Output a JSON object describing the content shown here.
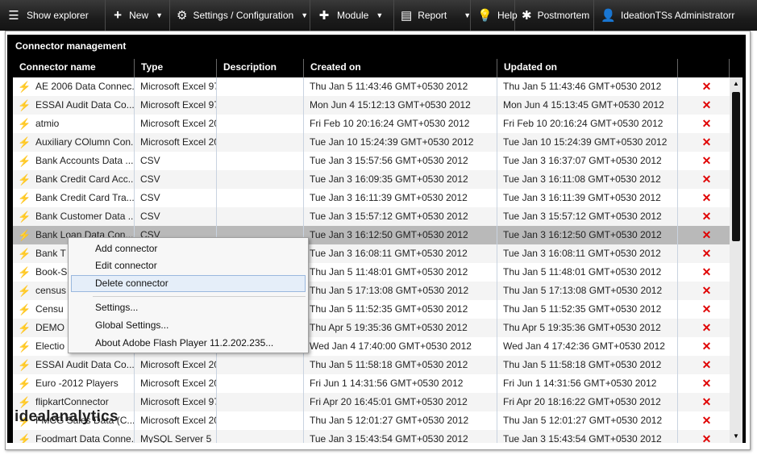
{
  "toolbar": {
    "show_explorer": "Show explorer",
    "new": "New",
    "settings": "Settings / Configuration",
    "module": "Module",
    "report": "Report",
    "help": "Help",
    "postmortem": "Postmortem",
    "user": "IdeationTSs Administratorr"
  },
  "panel": {
    "title": "Connector management"
  },
  "table": {
    "headers": [
      "Connector name",
      "Type",
      "Description",
      "Created on",
      "Updated on"
    ],
    "rows": [
      {
        "name": "AE 2006 Data Connec...",
        "type": "Microsoft Excel 97-",
        "created": "Thu Jan 5 11:43:46 GMT+0530 2012",
        "updated": "Thu Jan 5 11:43:46 GMT+0530 2012"
      },
      {
        "name": "ESSAI Audit Data Co...",
        "type": "Microsoft Excel 97-",
        "created": "Mon Jun 4 15:12:13 GMT+0530 2012",
        "updated": "Mon Jun 4 15:13:45 GMT+0530 2012"
      },
      {
        "name": "atmio",
        "type": "Microsoft Excel 200",
        "created": "Fri Feb 10 20:16:24 GMT+0530 2012",
        "updated": "Fri Feb 10 20:16:24 GMT+0530 2012"
      },
      {
        "name": "Auxiliary COlumn Con...",
        "type": "Microsoft Excel 200",
        "created": "Tue Jan 10 15:24:39 GMT+0530 2012",
        "updated": "Tue Jan 10 15:24:39 GMT+0530 2012"
      },
      {
        "name": "Bank Accounts Data ...",
        "type": "CSV",
        "created": "Tue Jan 3 15:57:56 GMT+0530 2012",
        "updated": "Tue Jan 3 16:37:07 GMT+0530 2012"
      },
      {
        "name": "Bank Credit Card Acc...",
        "type": "CSV",
        "created": "Tue Jan 3 16:09:35 GMT+0530 2012",
        "updated": "Tue Jan 3 16:11:08 GMT+0530 2012"
      },
      {
        "name": "Bank Credit Card Tra...",
        "type": "CSV",
        "created": "Tue Jan 3 16:11:39 GMT+0530 2012",
        "updated": "Tue Jan 3 16:11:39 GMT+0530 2012"
      },
      {
        "name": "Bank Customer Data ...",
        "type": "CSV",
        "created": "Tue Jan 3 15:57:12 GMT+0530 2012",
        "updated": "Tue Jan 3 15:57:12 GMT+0530 2012"
      },
      {
        "name": "Bank Loan Data Con...",
        "type": "CSV",
        "created": "Tue Jan 3 16:12:50 GMT+0530 2012",
        "updated": "Tue Jan 3 16:12:50 GMT+0530 2012"
      },
      {
        "name": "Bank T",
        "type": "",
        "created": "Tue Jan 3 16:08:11 GMT+0530 2012",
        "updated": "Tue Jan 3 16:08:11 GMT+0530 2012"
      },
      {
        "name": "Book-S",
        "type": "",
        "created": "Thu Jan 5 11:48:01 GMT+0530 2012",
        "updated": "Thu Jan 5 11:48:01 GMT+0530 2012"
      },
      {
        "name": "census",
        "type": "",
        "created": "Thu Jan 5 17:13:08 GMT+0530 2012",
        "updated": "Thu Jan 5 17:13:08 GMT+0530 2012"
      },
      {
        "name": "Censu",
        "type": "",
        "created": "Thu Jan 5 11:52:35 GMT+0530 2012",
        "updated": "Thu Jan 5 11:52:35 GMT+0530 2012"
      },
      {
        "name": "DEMO",
        "type": "",
        "created": "Thu Apr 5 19:35:36 GMT+0530 2012",
        "updated": "Thu Apr 5 19:35:36 GMT+0530 2012"
      },
      {
        "name": "Electio",
        "type": "",
        "created": "Wed Jan 4 17:40:00 GMT+0530 2012",
        "updated": "Wed Jan 4 17:42:36 GMT+0530 2012"
      },
      {
        "name": "ESSAI Audit Data Co...",
        "type": "Microsoft Excel 200",
        "created": "Thu Jan 5 11:58:18 GMT+0530 2012",
        "updated": "Thu Jan 5 11:58:18 GMT+0530 2012"
      },
      {
        "name": "Euro -2012 Players",
        "type": "Microsoft Excel 200",
        "created": "Fri Jun 1 14:31:56 GMT+0530 2012",
        "updated": "Fri Jun 1 14:31:56 GMT+0530 2012"
      },
      {
        "name": "flipkartConnector",
        "type": "Microsoft Excel 97-",
        "created": "Fri Apr 20 16:45:01 GMT+0530 2012",
        "updated": "Fri Apr 20 18:16:22 GMT+0530 2012"
      },
      {
        "name": "FMCG Sales Data (C...",
        "type": "Microsoft Excel 200",
        "created": "Thu Jan 5 12:01:27 GMT+0530 2012",
        "updated": "Thu Jan 5 12:01:27 GMT+0530 2012"
      },
      {
        "name": "Foodmart Data Conne...",
        "type": "MySQL Server 5",
        "created": "Tue Jan 3 15:43:54 GMT+0530 2012",
        "updated": "Tue Jan 3 15:43:54 GMT+0530 2012"
      }
    ],
    "selected_row": 8,
    "delete_glyph": "✕"
  },
  "context_menu": {
    "items": [
      "Add connector",
      "Edit connector",
      "Delete connector",
      "Settings...",
      "Global Settings...",
      "About Adobe Flash Player 11.2.202.235..."
    ],
    "highlighted": 2
  },
  "logo": {
    "part1": "ideal",
    "part2": "analytics"
  },
  "colors": {
    "delete": "#e00000",
    "header_bg": "#000000",
    "selection": "#b9b9b9"
  }
}
